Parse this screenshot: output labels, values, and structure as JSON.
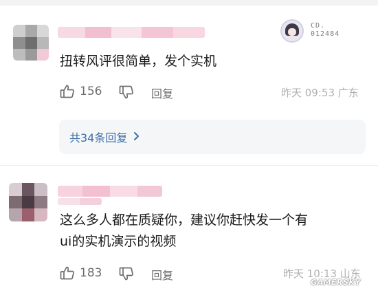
{
  "comments": [
    {
      "text_lines": [
        "扭转风评很简单，发个实机"
      ],
      "likes": "156",
      "reply_label": "回复",
      "time_location": "昨天 09:53 广东",
      "badge": {
        "line1": "CD.",
        "line2": "012484"
      },
      "replies_summary": "共34条回复"
    },
    {
      "text_lines": [
        "这么多人都在质疑你，建议你赶快发一个有",
        "ui的实机演示的视频"
      ],
      "likes": "183",
      "reply_label": "回复",
      "time_location": "昨天 10:13 山东"
    }
  ],
  "watermark": "GAMERSKY",
  "icons": {
    "like": "thumbs-up-icon",
    "dislike": "thumbs-down-icon",
    "chevron": "chevron-right-icon"
  },
  "colors": {
    "link": "#3a6fa8",
    "muted": "#6d6d6d",
    "meta": "#b0b0b0",
    "reply_bg": "#f5f6f8"
  }
}
